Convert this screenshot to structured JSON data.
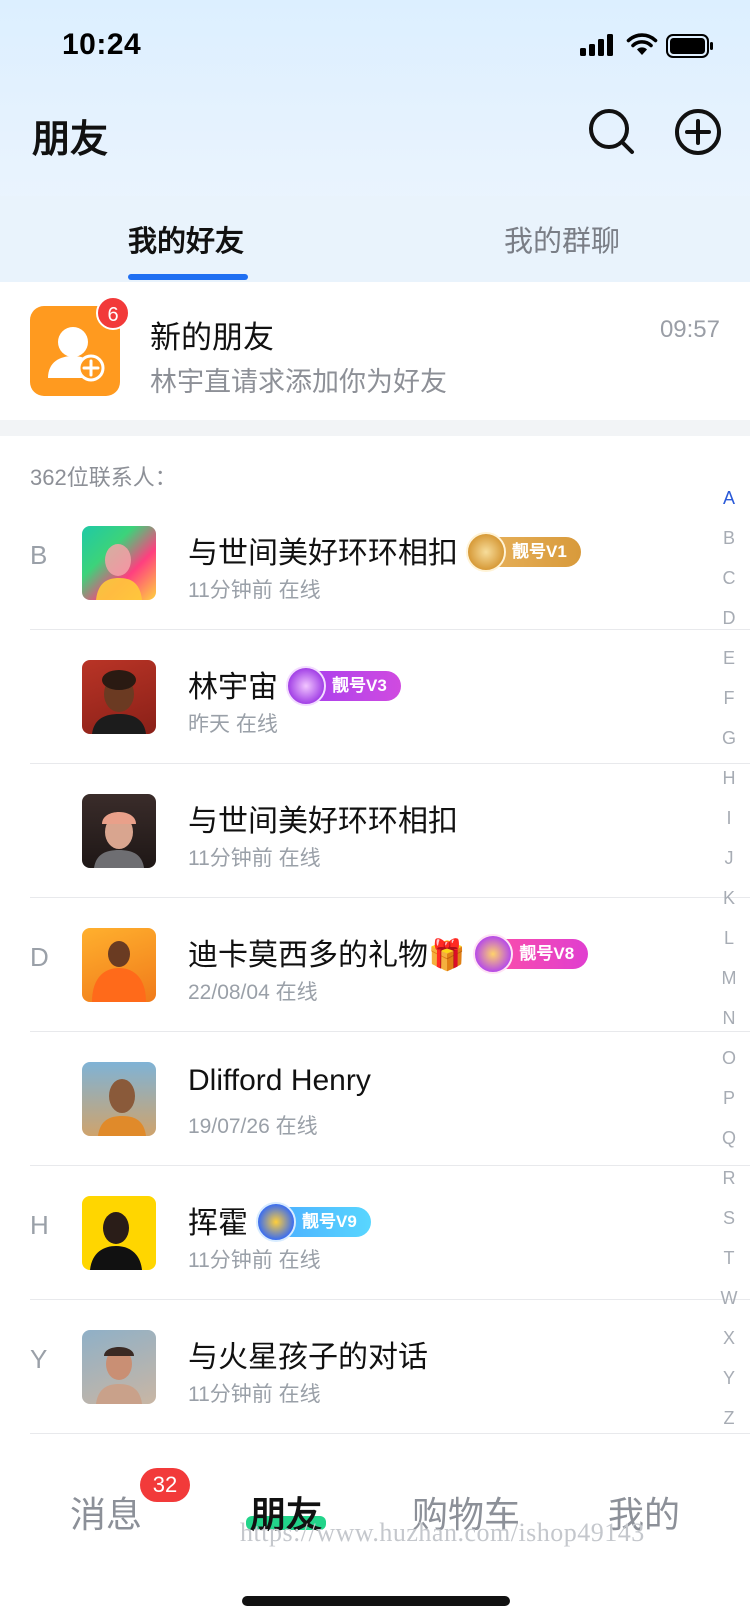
{
  "status_bar": {
    "time": "10:24"
  },
  "header": {
    "title": "朋友",
    "search_icon": "search-icon",
    "add_icon": "plus-circle-icon"
  },
  "tabs": [
    {
      "label": "我的好友",
      "active": true
    },
    {
      "label": "我的群聊",
      "active": false
    }
  ],
  "new_friends": {
    "title": "新的朋友",
    "subtitle": "林宇直请求添加你为好友",
    "time": "09:57",
    "badge": "6",
    "icon": "user-add-icon"
  },
  "contacts_count": "362位联系人：",
  "contacts": [
    {
      "letter": "B",
      "name": "与世间美好环环相扣",
      "badge": "靓号V1",
      "meta": "11分钟前 在线"
    },
    {
      "letter": "",
      "name": "林宇宙",
      "badge": "靓号V3",
      "meta": "昨天 在线"
    },
    {
      "letter": "",
      "name": "与世间美好环环相扣",
      "badge": "",
      "meta": "11分钟前 在线"
    },
    {
      "letter": "D",
      "name": "迪卡莫西多的礼物🎁",
      "badge": "靓号V8",
      "meta": "22/08/04 在线"
    },
    {
      "letter": "",
      "name": "Dlifford Henry",
      "badge": "",
      "meta": "19/07/26 在线"
    },
    {
      "letter": "H",
      "name": "挥霍",
      "badge": "靓号V9",
      "meta": "11分钟前 在线"
    },
    {
      "letter": "Y",
      "name": "与火星孩子的对话",
      "badge": "",
      "meta": "11分钟前 在线"
    }
  ],
  "index_letters": [
    "A",
    "B",
    "C",
    "D",
    "E",
    "F",
    "G",
    "H",
    "I",
    "J",
    "K",
    "L",
    "M",
    "N",
    "O",
    "P",
    "Q",
    "R",
    "S",
    "T",
    "W",
    "X",
    "Y",
    "Z"
  ],
  "tab_bar": {
    "items": [
      {
        "label": "消息",
        "badge": "32"
      },
      {
        "label": "朋友",
        "active": true
      },
      {
        "label": "购物车"
      },
      {
        "label": "我的"
      }
    ],
    "watermark": "https://www.huzhan.com/ishop49143"
  },
  "colors": {
    "accent": "#1f6ff2",
    "badge_red": "#f23a3a",
    "new_friend_orange": "#ff9a1f",
    "active_green": "#22d48a"
  }
}
